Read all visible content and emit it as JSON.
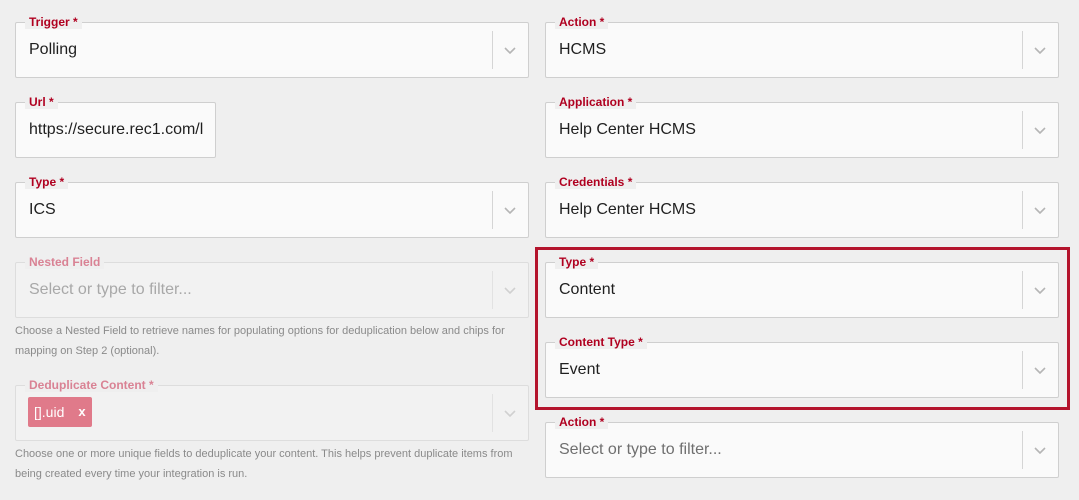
{
  "left": {
    "trigger": {
      "label": "Trigger *",
      "value": "Polling"
    },
    "url": {
      "label": "Url *",
      "value": "https://secure.rec1.com/l"
    },
    "type": {
      "label": "Type *",
      "value": "ICS"
    },
    "nested_field": {
      "label": "Nested Field",
      "placeholder": "Select or type to filter...",
      "hint": "Choose a Nested Field to retrieve names for populating options for deduplication below and chips for mapping on Step 2 (optional)."
    },
    "deduplicate": {
      "label": "Deduplicate Content *",
      "chip_label": "[].uid",
      "chip_remove": "x",
      "hint": "Choose one or more unique fields to deduplicate your content. This helps prevent duplicate items from being created every time your integration is run."
    }
  },
  "right": {
    "action": {
      "label": "Action *",
      "value": "HCMS"
    },
    "application": {
      "label": "Application *",
      "value": "Help Center HCMS"
    },
    "credentials": {
      "label": "Credentials *",
      "value": "Help Center HCMS"
    },
    "type": {
      "label": "Type *",
      "value": "Content"
    },
    "content_type": {
      "label": "Content Type *",
      "value": "Event"
    },
    "action2": {
      "label": "Action *",
      "placeholder": "Select or type to filter..."
    }
  },
  "colors": {
    "label_red": "#b00020",
    "highlight_border": "#b4142d",
    "chip_bg": "#e07a8a",
    "background": "#efefef"
  },
  "icons": {
    "dropdown": "chevron-down-icon",
    "chip_remove": "close-icon"
  }
}
